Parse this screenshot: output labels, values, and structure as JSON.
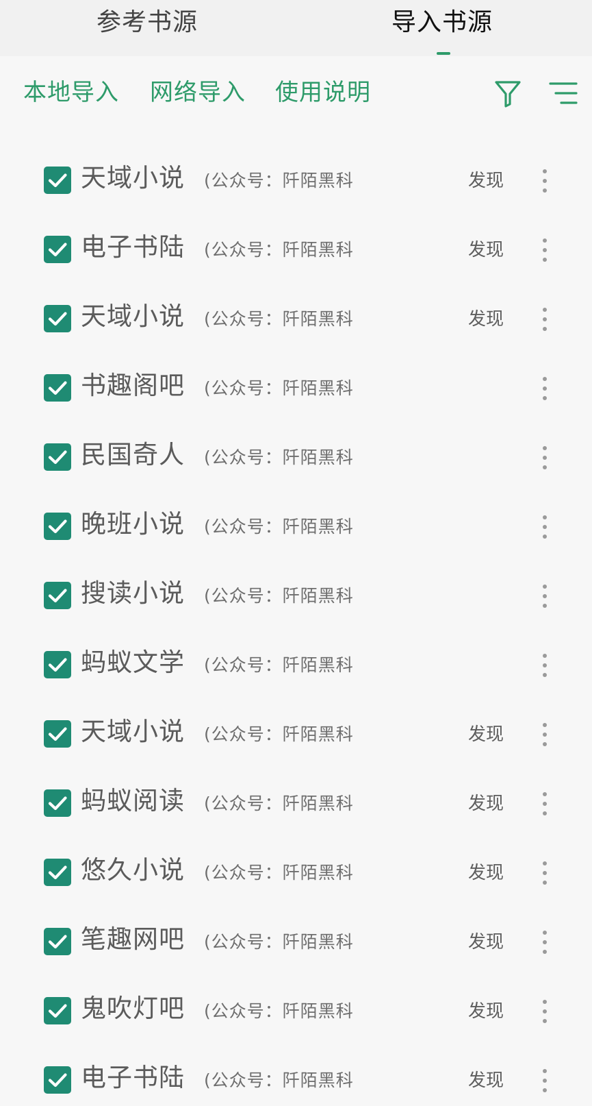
{
  "colors": {
    "accent": "#2e9b6a",
    "checkbox": "#1f8b73",
    "indicator": "#2e9b6a"
  },
  "tabs": [
    {
      "label": "参考书源",
      "active": false
    },
    {
      "label": "导入书源",
      "active": true
    }
  ],
  "actions": {
    "local_import": "本地导入",
    "network_import": "网络导入",
    "usage_guide": "使用说明",
    "filter_icon": "filter-icon",
    "sort_icon": "sort-lines-icon"
  },
  "sources": [
    {
      "name": "天域小说",
      "note": "(公众号：阡陌黑科",
      "discover": "发现",
      "checked": true
    },
    {
      "name": "电子书陆",
      "note": "(公众号：阡陌黑科",
      "discover": "发现",
      "checked": true
    },
    {
      "name": "天域小说",
      "note": "(公众号：阡陌黑科",
      "discover": "发现",
      "checked": true
    },
    {
      "name": "书趣阁吧",
      "note": "(公众号：阡陌黑科",
      "discover": "",
      "checked": true
    },
    {
      "name": "民国奇人",
      "note": "(公众号：阡陌黑科",
      "discover": "",
      "checked": true
    },
    {
      "name": "晚班小说",
      "note": "(公众号：阡陌黑科",
      "discover": "",
      "checked": true
    },
    {
      "name": "搜读小说",
      "note": "(公众号：阡陌黑科",
      "discover": "",
      "checked": true
    },
    {
      "name": "蚂蚁文学",
      "note": "(公众号：阡陌黑科",
      "discover": "",
      "checked": true
    },
    {
      "name": "天域小说",
      "note": "(公众号：阡陌黑科",
      "discover": "发现",
      "checked": true
    },
    {
      "name": "蚂蚁阅读",
      "note": "(公众号：阡陌黑科",
      "discover": "发现",
      "checked": true
    },
    {
      "name": "悠久小说",
      "note": "(公众号：阡陌黑科",
      "discover": "发现",
      "checked": true
    },
    {
      "name": "笔趣网吧",
      "note": "(公众号：阡陌黑科",
      "discover": "发现",
      "checked": true
    },
    {
      "name": "鬼吹灯吧",
      "note": "(公众号：阡陌黑科",
      "discover": "发现",
      "checked": true
    },
    {
      "name": "电子书陆",
      "note": "(公众号：阡陌黑科",
      "discover": "发现",
      "checked": true
    }
  ]
}
